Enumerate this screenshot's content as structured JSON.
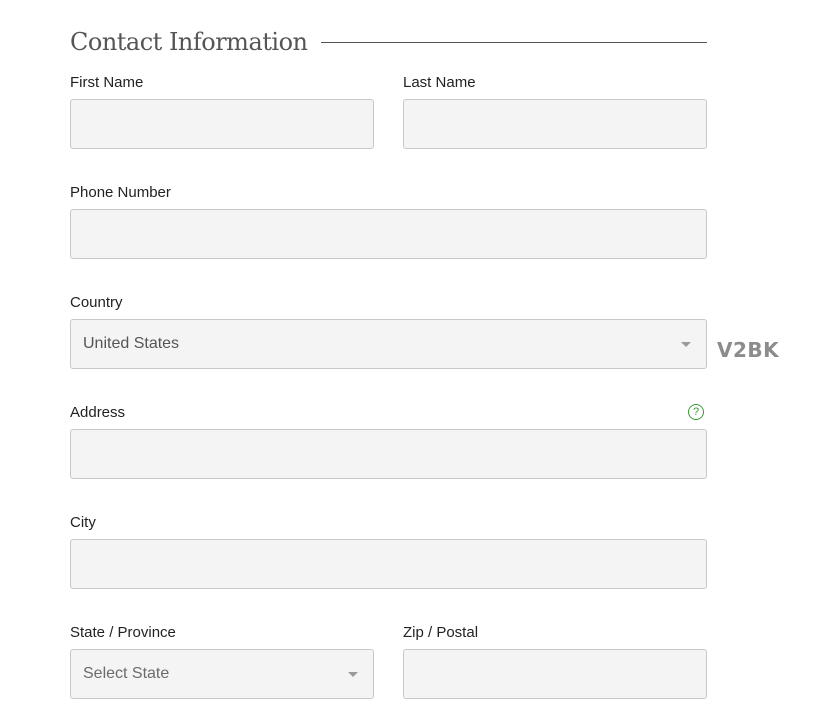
{
  "section": {
    "title": "Contact Information"
  },
  "fields": {
    "first_name": {
      "label": "First Name",
      "value": "",
      "placeholder": ""
    },
    "last_name": {
      "label": "Last Name",
      "value": "",
      "placeholder": ""
    },
    "phone": {
      "label": "Phone Number",
      "value": "",
      "placeholder": ""
    },
    "country": {
      "label": "Country",
      "selected": "United States"
    },
    "address": {
      "label": "Address",
      "value": "",
      "placeholder": "",
      "help_icon": "question-circle-icon",
      "help_glyph": "?"
    },
    "city": {
      "label": "City",
      "value": "",
      "placeholder": ""
    },
    "state": {
      "label": "State / Province",
      "placeholder": "Select State"
    },
    "zip": {
      "label": "Zip / Postal",
      "value": "",
      "placeholder": ""
    }
  },
  "watermark": "V2BK",
  "colors": {
    "field_background": "#f4f4f4",
    "field_border": "#c8c8c8",
    "help_icon": "#3a9a3a",
    "title": "#555555"
  }
}
